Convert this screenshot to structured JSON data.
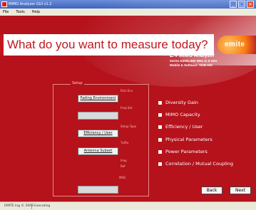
{
  "window": {
    "title": "MIMO Analyzer GUI v1.2",
    "minimize": "_",
    "maximize": "□",
    "close": "×"
  },
  "menu": [
    "File",
    "Tools",
    "Help"
  ],
  "banner": {
    "question": "What do you want to measure today?"
  },
  "logo": {
    "text": "emite"
  },
  "product": {
    "prefix": "E4",
    "name": "MIMO Analyzer",
    "line1": "Series E300a 850 MHz to 6 GHz",
    "line2": "Mobile & Software 750B HSI"
  },
  "setup": {
    "legend": "Setup",
    "buttons": [
      {
        "label": "Fading Environment",
        "enabled": true
      },
      {
        "label": "",
        "enabled": false
      },
      {
        "label": "Efficiency / User",
        "enabled": true
      },
      {
        "label": "Antenna Subset",
        "enabled": true
      },
      {
        "label": "",
        "enabled": false
      }
    ],
    "side_labels": [
      "Rich Env",
      "Freq Set",
      "Setup Type",
      "Tx/Rx",
      "Freq",
      "Ref",
      "MISC"
    ]
  },
  "options": [
    "Diversity Gain",
    "MIMO Capacity",
    "Efficiency / User",
    "Physical Parameters",
    "Power Parameters",
    "Correlation / Mutual Coupling"
  ],
  "nav": {
    "back": "Back",
    "next": "Next"
  },
  "status": {
    "left": "EMITE Ing © 2009",
    "right": "Executing"
  }
}
